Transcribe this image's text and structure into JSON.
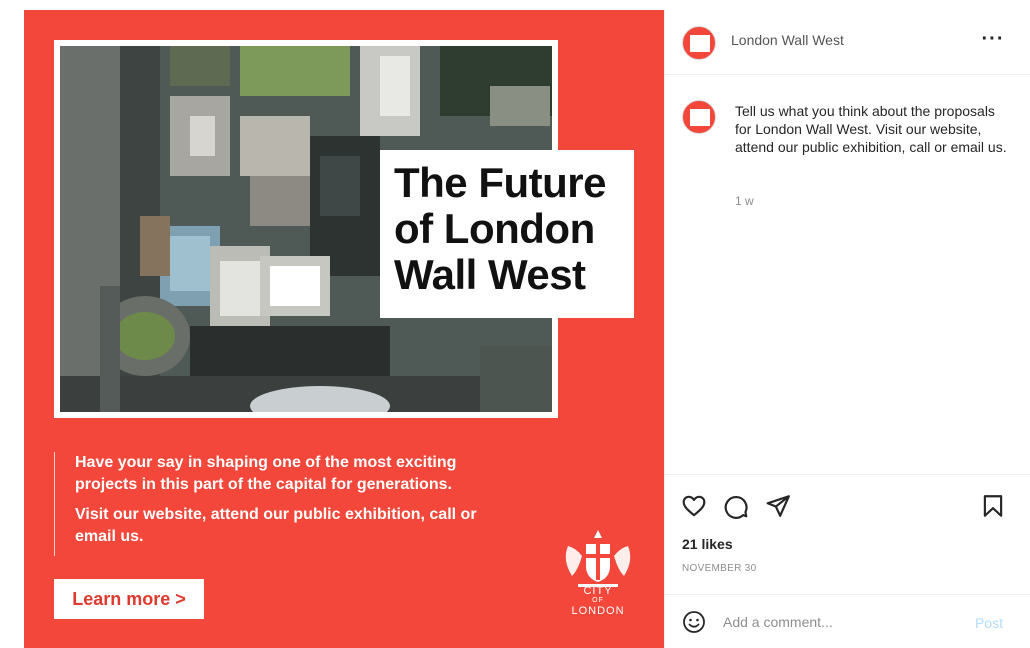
{
  "ad": {
    "headline": [
      "The Future",
      "of London",
      "Wall West"
    ],
    "paragraph_1": "Have your say in shaping one of the most exciting projects in this part of the capital for generations.",
    "paragraph_2": "Visit our website, attend our public exhibition, call or email us.",
    "cta_label": "Learn more >",
    "brand_line_1": "CITY",
    "brand_line_2": "LONDON",
    "brand_color": "#f2473a"
  },
  "header": {
    "username": "London Wall West",
    "more_icon": "more-horizontal-icon"
  },
  "post": {
    "caption": "Tell us what you think about the proposals for London Wall West. Visit our website, attend our public exhibition, call or email us.",
    "time_ago": "1 w",
    "likes": "21 likes",
    "date": "NOVEMBER 30"
  },
  "actions": {
    "like_icon": "heart-icon",
    "comment_icon": "comment-icon",
    "share_icon": "send-icon",
    "save_icon": "bookmark-icon"
  },
  "comment": {
    "placeholder": "Add a comment...",
    "post_label": "Post",
    "post_color": "#b3dbff"
  }
}
